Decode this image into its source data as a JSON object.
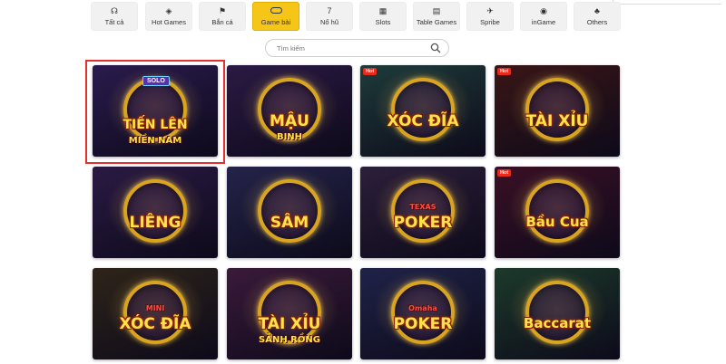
{
  "tabs": [
    {
      "label": "Tất cả",
      "icon": "headset-icon",
      "glyph": "☊"
    },
    {
      "label": "Hot Games",
      "icon": "diamond-icon",
      "glyph": "◈"
    },
    {
      "label": "Bắn cá",
      "icon": "fish-icon",
      "glyph": "⚑"
    },
    {
      "label": "Game bài",
      "icon": "cards-icon",
      "glyph": "",
      "active": true
    },
    {
      "label": "Nổ hũ",
      "icon": "seven-icon",
      "glyph": "7"
    },
    {
      "label": "Slots",
      "icon": "slot-machine-icon",
      "glyph": "▦"
    },
    {
      "label": "Table Games",
      "icon": "table-games-icon",
      "glyph": "▤"
    },
    {
      "label": "Spribe",
      "icon": "spribe-icon",
      "glyph": "✈"
    },
    {
      "label": "inGame",
      "icon": "ingame-icon",
      "glyph": "◉"
    },
    {
      "label": "Others",
      "icon": "clover-icon",
      "glyph": "♣"
    }
  ],
  "search": {
    "placeholder": "Tìm kiếm"
  },
  "hot_badge": "Hot",
  "games": [
    {
      "name": "TIẾN LÊN",
      "sub": "MIỀN NAM",
      "badge_top": "SOLO",
      "hot": false,
      "selected": true,
      "bg": "#2a1b4d"
    },
    {
      "name": "MẬU",
      "sub": "BINH",
      "hot": false,
      "bg": "#2b1a44"
    },
    {
      "name": "XÓC ĐĨA",
      "sub": "",
      "hot": true,
      "bg": "#1e3b3a"
    },
    {
      "name": "TÀI XỈU",
      "sub": "",
      "hot": true,
      "bg": "#3a1616"
    },
    {
      "name": "LIÊNG",
      "sub": "",
      "hot": false,
      "bg": "#2b1a44"
    },
    {
      "name": "SÂM",
      "sub": "",
      "hot": false,
      "bg": "#24244a"
    },
    {
      "name": "POKER",
      "sub": "TEXAS",
      "hot": false,
      "bg": "#2c1f3a"
    },
    {
      "name": "Bầu Cua",
      "sub": "",
      "hot": true,
      "bg": "#3a1025"
    },
    {
      "name": "XÓC ĐĨA",
      "sub": "MINI",
      "hot": false,
      "bg": "#2e2419"
    },
    {
      "name": "TÀI XỈU",
      "sub": "SẢNH RỒNG",
      "hot": false,
      "bg": "#3a1a3a"
    },
    {
      "name": "POKER",
      "sub": "Omaha",
      "hot": false,
      "bg": "#1f2348"
    },
    {
      "name": "Baccarat",
      "sub": "",
      "hot": false,
      "bg": "#1c3a2a"
    }
  ]
}
